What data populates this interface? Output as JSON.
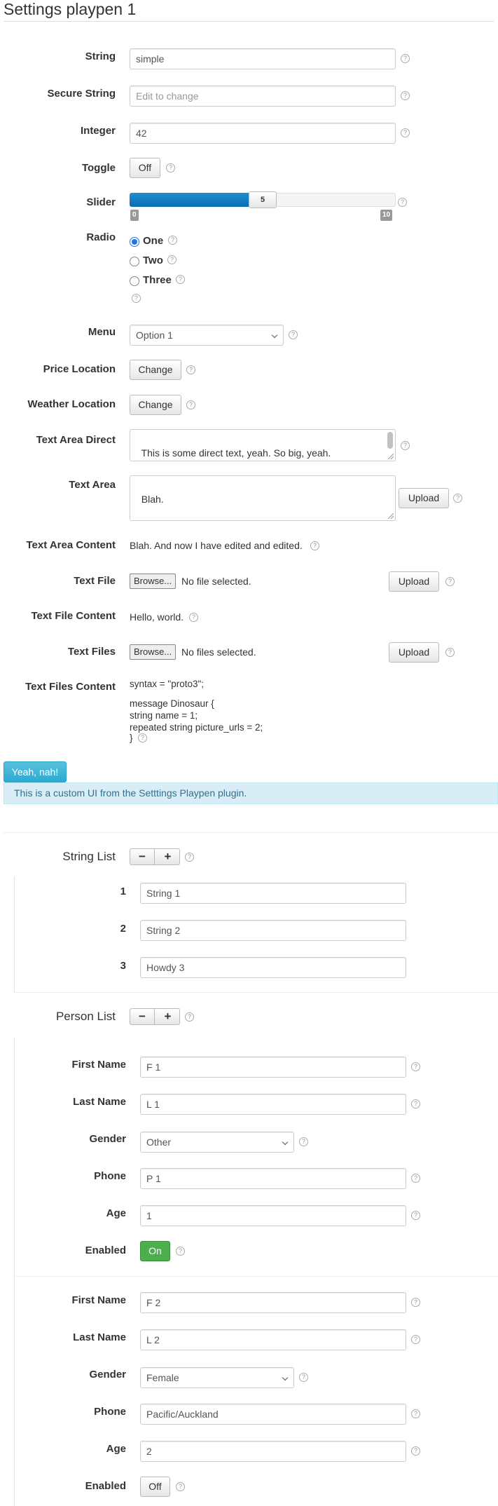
{
  "title": "Settings playpen 1",
  "help_glyph": "?",
  "accent_color": "#1e8ed2",
  "settings": {
    "string": {
      "label": "String",
      "value": "simple"
    },
    "secure_string": {
      "label": "Secure String",
      "placeholder": "Edit to change"
    },
    "integer": {
      "label": "Integer",
      "value": "42"
    },
    "toggle": {
      "label": "Toggle",
      "value": "Off"
    },
    "slider": {
      "label": "Slider",
      "value": "5",
      "min": "0",
      "max": "10"
    },
    "radio": {
      "label": "Radio",
      "options": [
        {
          "label": "One",
          "checked": true
        },
        {
          "label": "Two",
          "checked": false
        },
        {
          "label": "Three",
          "checked": false
        }
      ]
    },
    "menu": {
      "label": "Menu",
      "value": "Option 1"
    },
    "price_location": {
      "label": "Price Location",
      "button": "Change"
    },
    "weather_location": {
      "label": "Weather Location",
      "button": "Change"
    },
    "text_area_direct": {
      "label": "Text Area Direct",
      "value": "This is some direct text, yeah. So big, yeah.\nAnd with line breaks!"
    },
    "text_area": {
      "label": "Text Area",
      "value": "Blah.",
      "button": "Upload"
    },
    "text_area_content": {
      "label": "Text Area Content",
      "value": "Blah. And now I have edited and edited."
    },
    "text_file": {
      "label": "Text File",
      "browse": "Browse...",
      "status": "No file selected.",
      "button": "Upload"
    },
    "text_file_content": {
      "label": "Text File Content",
      "value": "Hello, world."
    },
    "text_files": {
      "label": "Text Files",
      "browse": "Browse...",
      "status": "No files selected.",
      "button": "Upload"
    },
    "text_files_content": {
      "label": "Text Files Content",
      "line1": "syntax = \"proto3\";",
      "block": "message Dinosaur {\nstring name = 1;\nrepeated string picture_urls = 2;",
      "closing": "}"
    }
  },
  "custom_button": "Yeah, nah!",
  "alert": "This is a custom UI from the Setttings Playpen plugin.",
  "string_list": {
    "label": "String List",
    "minus": "−",
    "plus": "+",
    "items": [
      {
        "index": "1",
        "value": "String 1"
      },
      {
        "index": "2",
        "value": "String 2"
      },
      {
        "index": "3",
        "value": "Howdy 3"
      }
    ]
  },
  "person_list": {
    "label": "Person List",
    "minus": "−",
    "plus": "+",
    "field_labels": {
      "first_name": "First Name",
      "last_name": "Last Name",
      "gender": "Gender",
      "phone": "Phone",
      "age": "Age",
      "enabled": "Enabled"
    },
    "people": [
      {
        "first_name": "F 1",
        "last_name": "L 1",
        "gender": "Other",
        "phone": "P 1",
        "age": "1",
        "enabled": "On"
      },
      {
        "first_name": "F 2",
        "last_name": "L 2",
        "gender": "Female",
        "phone": "Pacific/Auckland",
        "age": "2",
        "enabled": "Off"
      }
    ]
  }
}
